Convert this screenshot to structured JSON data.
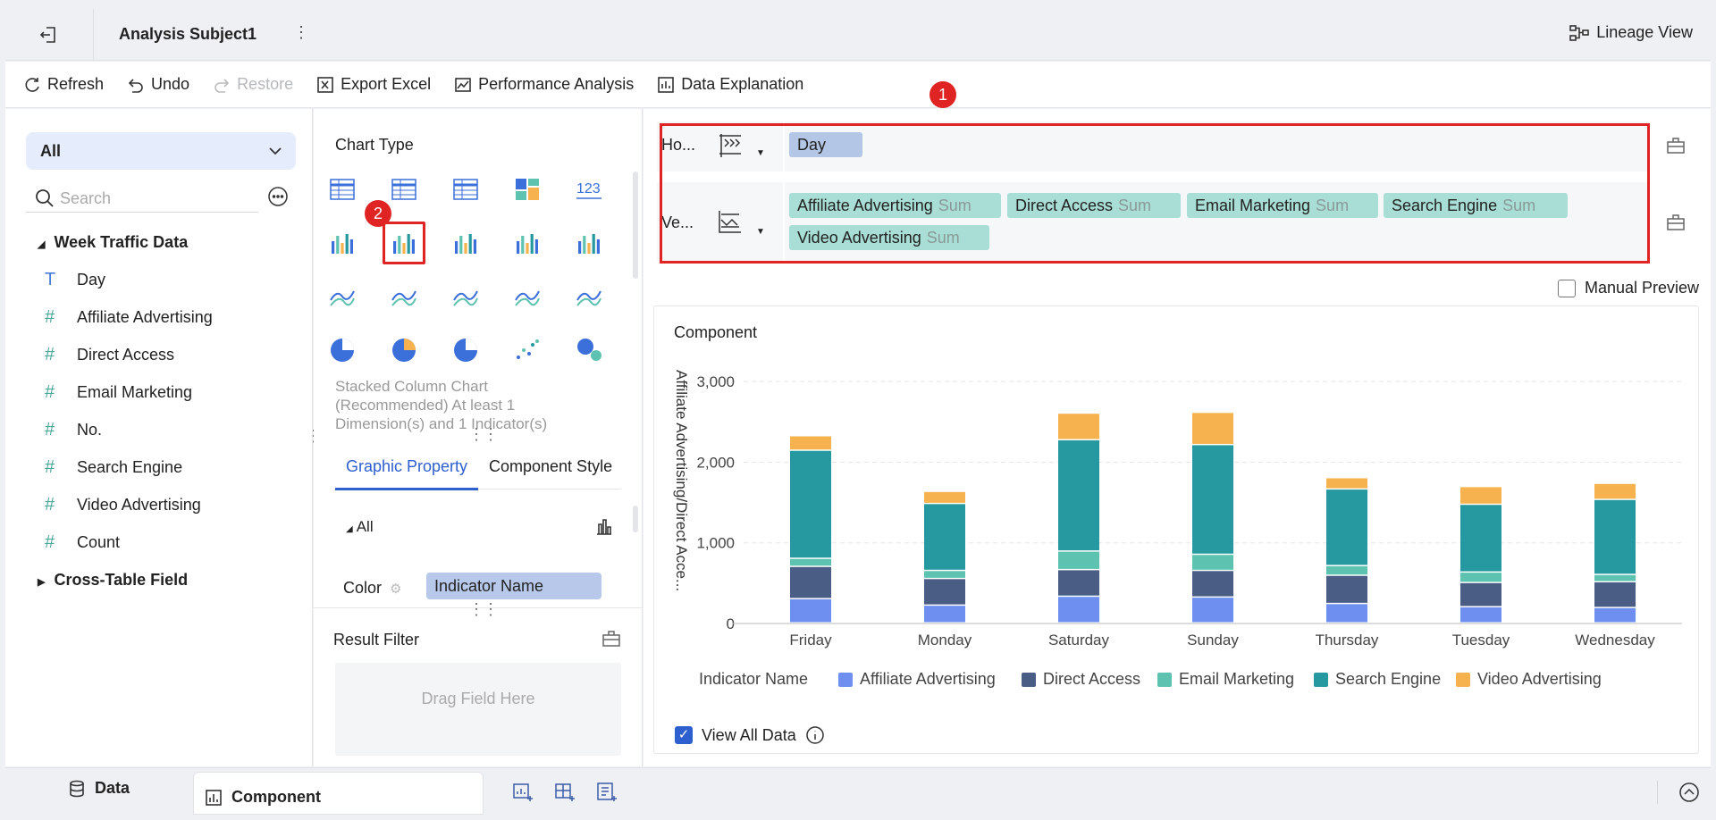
{
  "header": {
    "title": "Analysis Subject1",
    "lineage_label": "Lineage View"
  },
  "toolbar": {
    "refresh": "Refresh",
    "undo": "Undo",
    "restore": "Restore",
    "export_excel": "Export Excel",
    "performance_analysis": "Performance Analysis",
    "data_explanation": "Data Explanation"
  },
  "left_panel": {
    "filter_value": "All",
    "search_placeholder": "Search",
    "tree_group": "Week Traffic Data",
    "fields": [
      {
        "name": "Day",
        "type": "text"
      },
      {
        "name": "Affiliate Advertising",
        "type": "number"
      },
      {
        "name": "Direct Access",
        "type": "number"
      },
      {
        "name": "Email Marketing",
        "type": "number"
      },
      {
        "name": "No.",
        "type": "number"
      },
      {
        "name": "Search Engine",
        "type": "number"
      },
      {
        "name": "Video Advertising",
        "type": "number"
      },
      {
        "name": "Count",
        "type": "count"
      }
    ],
    "tree_group2": "Cross-Table Field"
  },
  "middle_panel": {
    "chart_type_label": "Chart Type",
    "chart_description": "Stacked Column Chart (Recommended) At least 1 Dimension(s) and 1 Indicator(s)",
    "tab_graphic": "Graphic Property",
    "tab_component_style": "Component Style",
    "all_label": "All",
    "color_label": "Color",
    "color_value": "Indicator Name",
    "result_filter_label": "Result Filter",
    "drag_field_label": "Drag Field Here",
    "badge2": "2"
  },
  "axes": {
    "horizontal_label": "Ho...",
    "vertical_label": "Ve...",
    "horizontal_fields": [
      {
        "name": "Day"
      }
    ],
    "vertical_fields": [
      {
        "name": "Affiliate Advertising",
        "agg": "Sum"
      },
      {
        "name": "Direct Access",
        "agg": "Sum"
      },
      {
        "name": "Email Marketing",
        "agg": "Sum"
      },
      {
        "name": "Search Engine",
        "agg": "Sum"
      },
      {
        "name": "Video Advertising",
        "agg": "Sum"
      }
    ],
    "badge1": "1"
  },
  "preview": {
    "manual_preview": "Manual Preview",
    "component_title": "Component",
    "view_all_data": "View All Data"
  },
  "chart_data": {
    "type": "bar",
    "stacked": true,
    "categories": [
      "Friday",
      "Monday",
      "Saturday",
      "Sunday",
      "Thursday",
      "Tuesday",
      "Wednesday"
    ],
    "ylabel": "Affiliate Advertising/Direct Acce...",
    "ylim": [
      0,
      3300
    ],
    "yticks": [
      0,
      1000,
      2000,
      3000
    ],
    "ytick_labels": [
      "0",
      "1,000",
      "2,000",
      "3,000"
    ],
    "legend_title": "Indicator Name",
    "legend_position": "bottom",
    "grid": true,
    "series": [
      {
        "name": "Affiliate Advertising",
        "color": "#6f8ff0",
        "values": [
          300,
          220,
          330,
          320,
          240,
          200,
          190
        ]
      },
      {
        "name": "Direct Access",
        "color": "#4a5d85",
        "values": [
          400,
          330,
          330,
          330,
          350,
          300,
          320
        ]
      },
      {
        "name": "Email Marketing",
        "color": "#5dc2b0",
        "values": [
          100,
          100,
          230,
          200,
          120,
          130,
          90
        ]
      },
      {
        "name": "Search Engine",
        "color": "#25999f",
        "values": [
          1340,
          830,
          1380,
          1360,
          950,
          840,
          930
        ]
      },
      {
        "name": "Video Advertising",
        "color": "#f5b24e",
        "values": [
          180,
          150,
          330,
          400,
          140,
          220,
          200
        ]
      }
    ]
  },
  "bottom_bar": {
    "data_tab": "Data",
    "component_tab": "Component"
  }
}
